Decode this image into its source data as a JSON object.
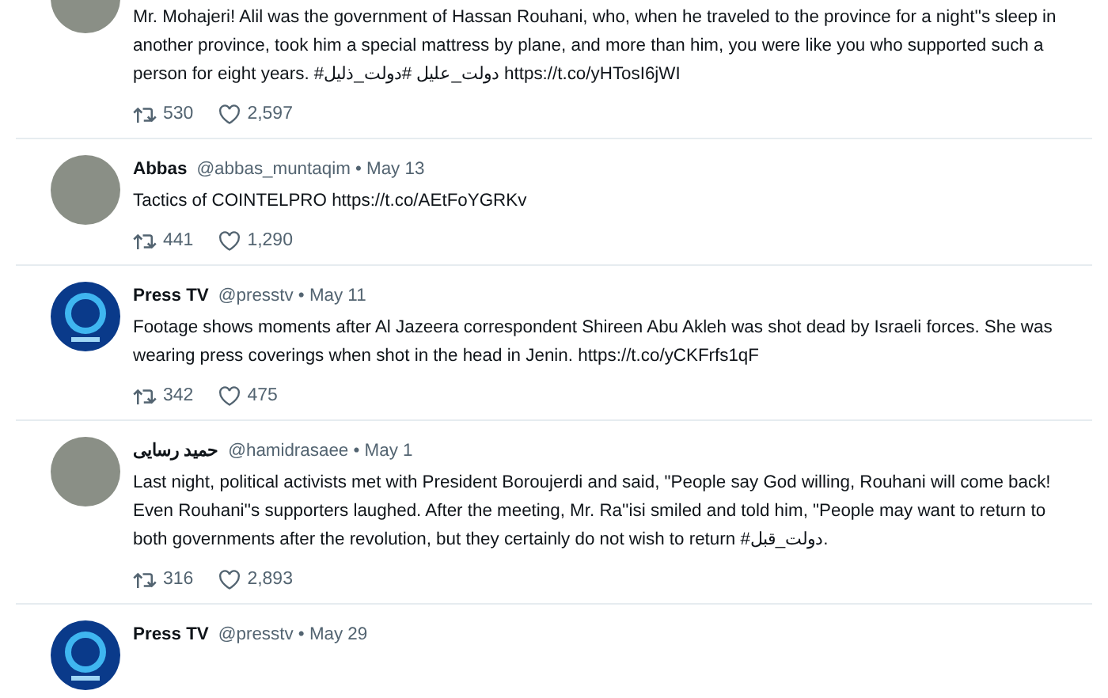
{
  "tweets": [
    {
      "kind": "person",
      "text": "Mr. Mohajeri! Alil was the government of Hassan Rouhani, who, when he traveled to the province for a night''s sleep in another province, took him a special mattress by plane, and more than him, you were like you who supported such a person for eight years. #دولت_علیل #دولت_ذلیل https://t.co/yHTosI6jWI",
      "retweets": "530",
      "likes": "2,597"
    },
    {
      "kind": "person",
      "name": "Abbas",
      "meta": "@abbas_muntaqim • May 13",
      "text": "Tactics of COINTELPRO https://t.co/AEtFoYGRKv",
      "retweets": "441",
      "likes": "1,290"
    },
    {
      "kind": "logo",
      "name": "Press TV",
      "meta": "@presstv • May 11",
      "text": "Footage shows moments after Al Jazeera correspondent Shireen Abu Akleh was shot dead by Israeli forces. She was wearing press coverings when shot in the head in Jenin. https://t.co/yCKFrfs1qF",
      "retweets": "342",
      "likes": "475"
    },
    {
      "kind": "person",
      "name": "حمید رسایی",
      "meta": "@hamidrasaee • May 1",
      "text": "Last night, political activists met with President Boroujerdi and said, \"People say God willing, Rouhani will come back! Even Rouhani''s supporters laughed. After the meeting, Mr. Ra''isi smiled and told him, \"People may want to return to both governments after the revolution, but they certainly do not wish to return #دولت_قبل.",
      "retweets": "316",
      "likes": "2,893"
    },
    {
      "kind": "logo",
      "name": "Press TV",
      "meta": "@presstv • May 29"
    }
  ]
}
